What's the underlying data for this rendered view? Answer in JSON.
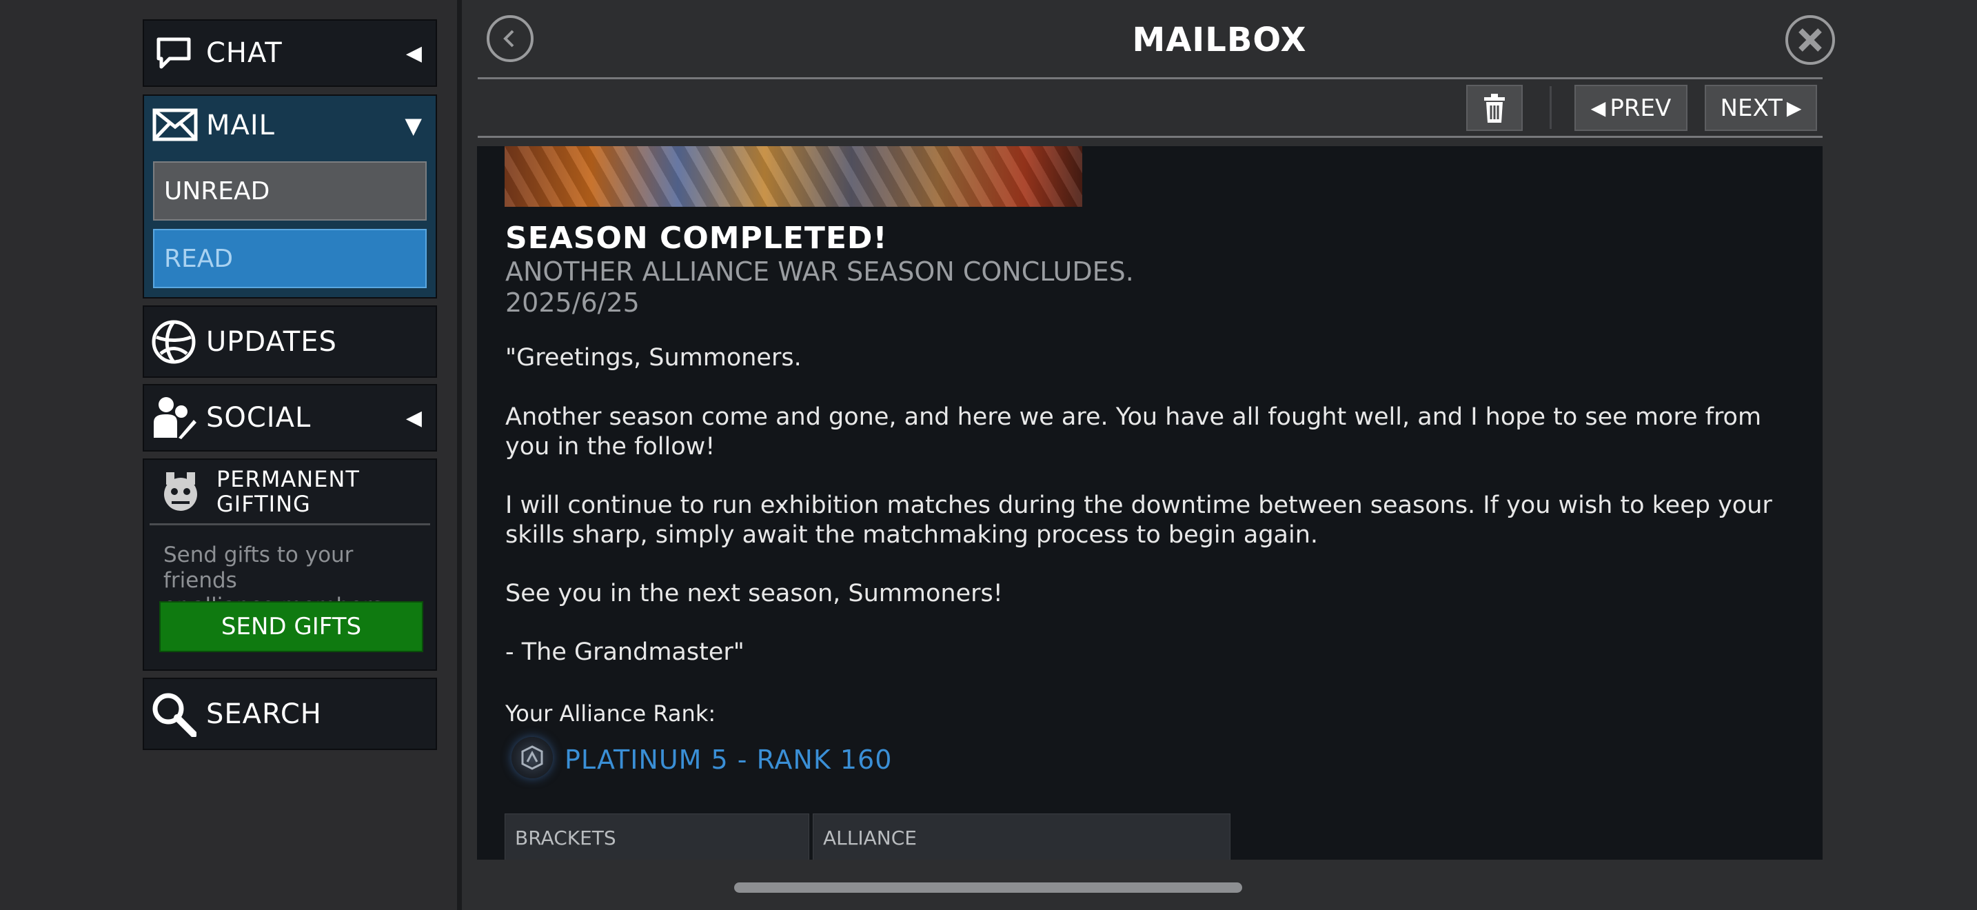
{
  "sidebar": {
    "chat_label": "CHAT",
    "mail_label": "MAIL",
    "unread_label": "UNREAD",
    "read_label": "READ",
    "updates_label": "UPDATES",
    "social_label": "SOCIAL",
    "gifting_title_line1": "PERMANENT",
    "gifting_title_line2": "GIFTING",
    "gifting_desc_line1": "Send gifts to your friends",
    "gifting_desc_line2": "or alliance members.",
    "send_gifts_label": "SEND GIFTS",
    "search_label": "SEARCH"
  },
  "header": {
    "title": "MAILBOX",
    "prev_label": "PREV",
    "next_label": "NEXT"
  },
  "message": {
    "title": "SEASON COMPLETED!",
    "subtitle": "ANOTHER ALLIANCE WAR SEASON CONCLUDES.",
    "date": "2025/6/25",
    "para1": "\"Greetings, Summoners.",
    "para2": "Another season come and gone, and here we are. You have all fought well, and I hope to see more from you in the follow!",
    "para3": "I will continue to run exhibition matches during the downtime between seasons. If you wish to keep your skills sharp, simply await the matchmaking process to begin again.",
    "para4": "See you in the next season, Summoners!",
    "para5": "- The Grandmaster\"",
    "rank_label": "Your Alliance Rank:",
    "rank_value": "PLATINUM 5 - RANK 160",
    "table_headers": [
      "BRACKETS",
      "ALLIANCE"
    ]
  },
  "colors": {
    "read_selected": "#2a7fc1",
    "send_gifts": "#0f7a10",
    "rank_text": "#3a8fd6"
  }
}
